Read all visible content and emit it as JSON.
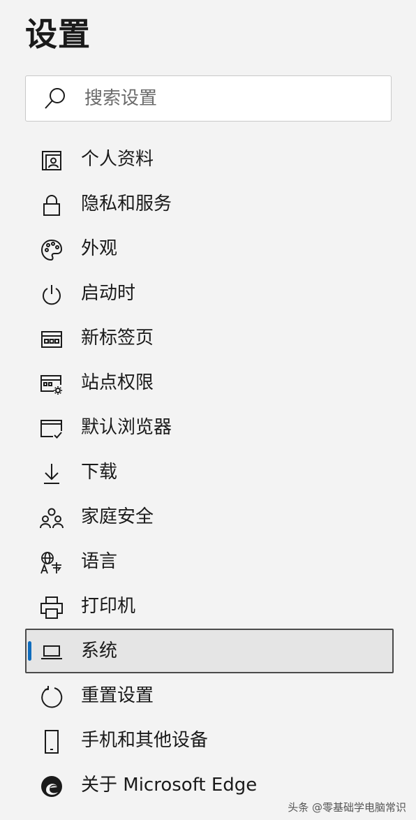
{
  "page": {
    "title": "设置"
  },
  "search": {
    "placeholder": "搜索设置",
    "icon": "search-icon"
  },
  "nav": {
    "items": [
      {
        "label": "个人资料",
        "icon": "profile-icon"
      },
      {
        "label": "隐私和服务",
        "icon": "lock-icon"
      },
      {
        "label": "外观",
        "icon": "palette-icon"
      },
      {
        "label": "启动时",
        "icon": "power-icon"
      },
      {
        "label": "新标签页",
        "icon": "new-tab-icon"
      },
      {
        "label": "站点权限",
        "icon": "site-permissions-icon"
      },
      {
        "label": "默认浏览器",
        "icon": "default-browser-icon"
      },
      {
        "label": "下载",
        "icon": "download-icon"
      },
      {
        "label": "家庭安全",
        "icon": "family-icon"
      },
      {
        "label": "语言",
        "icon": "language-icon"
      },
      {
        "label": "打印机",
        "icon": "printer-icon"
      },
      {
        "label": "系统",
        "icon": "laptop-icon",
        "selected": true
      },
      {
        "label": "重置设置",
        "icon": "reset-icon"
      },
      {
        "label": "手机和其他设备",
        "icon": "phone-icon"
      },
      {
        "label": "关于 Microsoft Edge",
        "icon": "edge-icon"
      }
    ]
  },
  "colors": {
    "accent": "#0f6cbd",
    "background": "#f3f3f3",
    "selected_background": "#e5e5e5"
  },
  "watermark": {
    "text": "头条 @零基础学电脑常识"
  }
}
